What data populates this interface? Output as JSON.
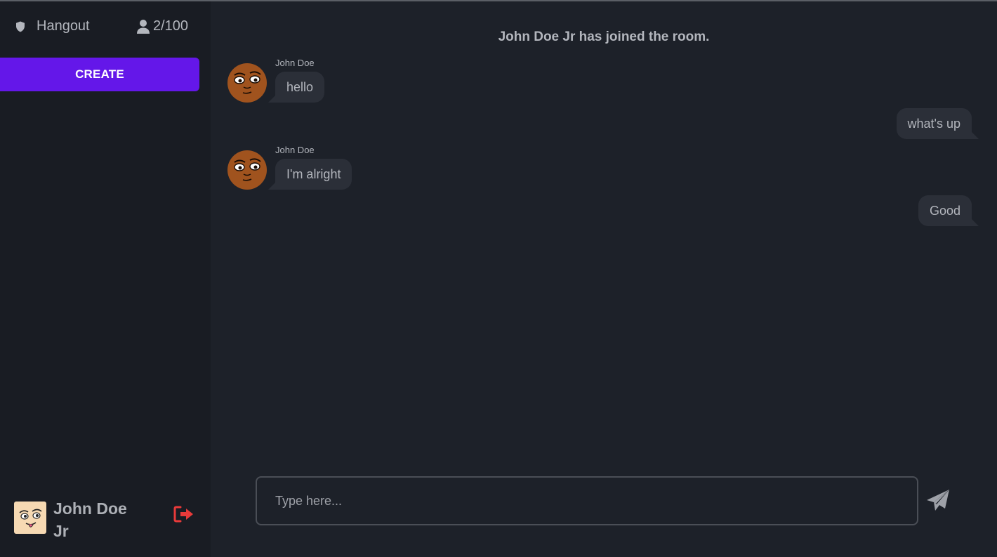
{
  "sidebar": {
    "room_name": "Hangout",
    "member_count": "2/100",
    "create_label": "CREATE",
    "current_user": {
      "name": "John Doe Jr"
    }
  },
  "chat": {
    "system_message": "John Doe Jr has joined the room.",
    "messages": [
      {
        "author": "John Doe",
        "text": "hello",
        "direction": "in"
      },
      {
        "author": "",
        "text": "what's up",
        "direction": "out"
      },
      {
        "author": "John Doe",
        "text": "I'm alright",
        "direction": "in"
      },
      {
        "author": "",
        "text": "Good",
        "direction": "out"
      }
    ]
  },
  "composer": {
    "placeholder": "Type here...",
    "value": ""
  },
  "icons": {
    "room": "shield-icon",
    "members": "user-icon",
    "logout": "logout-icon",
    "send": "paper-plane-icon"
  },
  "colors": {
    "accent": "#6417e9",
    "logout": "#e83a3a",
    "sidebar_bg": "#191c23",
    "main_bg": "#1d2129",
    "bubble_bg": "#2b2f38"
  }
}
